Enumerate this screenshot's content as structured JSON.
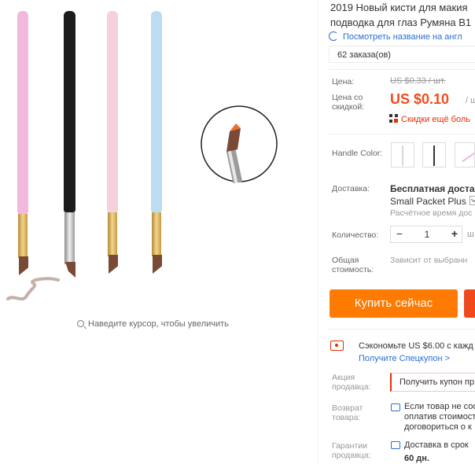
{
  "gallery": {
    "zoom_hint": "Наведите курсор, чтобы увеличить",
    "handle_colors": [
      "#f2b9de",
      "#1c1c1c",
      "#f5d0dd",
      "#bcdcf2"
    ],
    "tip_color": "#7a4a36"
  },
  "product": {
    "title_line1": "2019 Новый кисти для макия",
    "title_line2": "подводка для глаз Румяна B1",
    "translate_link": "Посмотреть название на англ",
    "orders": "62 заказа(ов)",
    "price_label": "Цена:",
    "old_price": "US $0.33 / шт.",
    "discount_label_1": "Цена со",
    "discount_label_2": "скидкой:",
    "price": "US $0.10",
    "price_unit": "/ шт",
    "discount_link": "Скидки ещё боль",
    "handle_color_label": "Handle Color:",
    "shipping_label": "Доставка:",
    "shipping_title": "Бесплатная доставк",
    "shipping_method": "Small Packet Plus",
    "shipping_est": "Расчётное время дос",
    "quantity_label": "Количество:",
    "quantity_minus": "−",
    "quantity_value": "1",
    "quantity_plus": "+",
    "quantity_unit": "ш",
    "total_label_1": "Общая",
    "total_label_2": "стоимость:",
    "total_text": "Зависит от выбранн",
    "buy_now": "Купить сейчас",
    "save_text": "Сэкономьте US $6.00 с кажд",
    "get_coupon": "Получите Спецкупон >",
    "promo_label_1": "Акция",
    "promo_label_2": "продавца:",
    "promo_button": "Получить купон пр",
    "return_label_1": "Возврат",
    "return_label_2": "товара:",
    "return_line1": "Если товар не соо",
    "return_line2": "оплатив стоимост",
    "return_line3": "договориться о к",
    "guarantee_label_1": "Гарантии",
    "guarantee_label_2": "продавца:",
    "guarantee_line1": "Доставка в срок",
    "guarantee_line2": "60 дн."
  },
  "colors": {
    "accent": "#ff7a00",
    "price": "#f24c1e",
    "link": "#2b6fd0"
  }
}
